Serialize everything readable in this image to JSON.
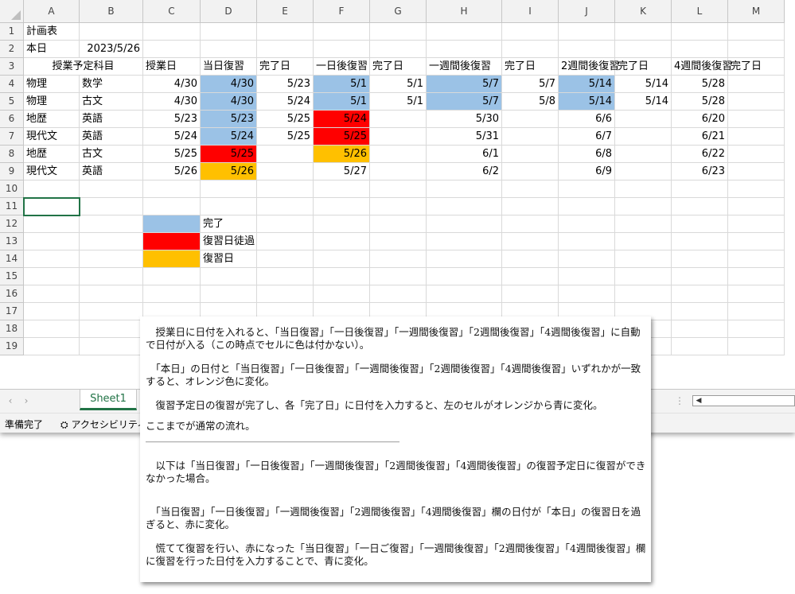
{
  "sheet": {
    "columns": [
      "A",
      "B",
      "C",
      "D",
      "E",
      "F",
      "G",
      "H",
      "I",
      "J",
      "K",
      "L",
      "M"
    ],
    "rows": [
      "1",
      "2",
      "3",
      "4",
      "5",
      "6",
      "7",
      "8",
      "9",
      "10",
      "11",
      "12",
      "13",
      "14",
      "15",
      "16",
      "17",
      "18",
      "19"
    ],
    "cells": {
      "A1": "計画表",
      "A2": "本日",
      "B2": "2023/5/26",
      "A3": "授業予定科目",
      "C3": "授業日",
      "D3": "当日復習",
      "E3": "完了日",
      "F3": "一日後復習",
      "G3": "完了日",
      "H3": "一週間後復習",
      "I3": "完了日",
      "J3": "2週間後復習",
      "K3": "完了日",
      "L3": "4週間後復習",
      "M3": "完了日",
      "A4": "物理",
      "B4": "数学",
      "C4": "4/30",
      "D4": "4/30",
      "E4": "5/23",
      "F4": "5/1",
      "G4": "5/1",
      "H4": "5/7",
      "I4": "5/7",
      "J4": "5/14",
      "K4": "5/14",
      "L4": "5/28",
      "A5": "物理",
      "B5": "古文",
      "C5": "4/30",
      "D5": "4/30",
      "E5": "5/24",
      "F5": "5/1",
      "G5": "5/1",
      "H5": "5/7",
      "I5": "5/8",
      "J5": "5/14",
      "K5": "5/14",
      "L5": "5/28",
      "A6": "地歴",
      "B6": "英語",
      "C6": "5/23",
      "D6": "5/23",
      "E6": "5/25",
      "F6": "5/24",
      "H6": "5/30",
      "J6": "6/6",
      "L6": "6/20",
      "A7": "現代文",
      "B7": "英語",
      "C7": "5/24",
      "D7": "5/24",
      "E7": "5/25",
      "F7": "5/25",
      "H7": "5/31",
      "J7": "6/7",
      "L7": "6/21",
      "A8": "地歴",
      "B8": "古文",
      "C8": "5/25",
      "D8": "5/25",
      "F8": "5/26",
      "H8": "6/1",
      "J8": "6/8",
      "L8": "6/22",
      "A9": "現代文",
      "B9": "英語",
      "C9": "5/26",
      "D9": "5/26",
      "F9": "5/27",
      "H9": "6/2",
      "J9": "6/9",
      "L9": "6/23",
      "D12": "完了",
      "D13": "復習日徒過",
      "D14": "復習日"
    },
    "fills": {
      "D4": "#9bc2e6",
      "F4": "#9bc2e6",
      "H4": "#9bc2e6",
      "J4": "#9bc2e6",
      "D5": "#9bc2e6",
      "F5": "#9bc2e6",
      "H5": "#9bc2e6",
      "J5": "#9bc2e6",
      "D6": "#9bc2e6",
      "F6": "#ff0000",
      "D7": "#9bc2e6",
      "F7": "#ff0000",
      "D8": "#ff0000",
      "F8": "#ffc000",
      "D9": "#ffc000",
      "C12": "#9bc2e6",
      "C13": "#ff0000",
      "C14": "#ffc000"
    },
    "colors": {
      "complete": "#9bc2e6",
      "overdue": "#ff0000",
      "due": "#ffc000",
      "accent": "#217346"
    }
  },
  "tabs": {
    "sheet1": "Sheet1",
    "nav_prev": "‹",
    "nav_next": "›",
    "add": "⊕",
    "more": "⋮"
  },
  "status": {
    "ready": "準備完了",
    "accessibility": "アクセシビリティ: 検"
  },
  "note": {
    "paragraphs": [
      "　授業日に日付を入れると、「当日復習」「一日後復習」「一週間後復習」「2週間後復習」「4週間後復習」に自動で日付が入る（この時点でセルに色は付かない）。",
      "　「本日」の日付と「当日復習」「一日後復習」「一週間後復習」「2週間後復習」「4週間後復習」いずれかが一致すると、オレンジ色に変化。",
      "　復習予定日の復習が完了し、各「完了日」に日付を入力すると、左のセルがオレンジから青に変化。",
      "ここまでが通常の流れ。",
      "―――――――――――――――――――――――――――――",
      "　以下は「当日復習」「一日後復習」「一週間後復習」「2週間後復習」「4週間後復習」の復習予定日に復習ができなかった場合。",
      "　「当日復習」「一日後復習」「一週間後復習」「2週間後復習」「4週間後復習」欄の日付が「本日」の復習日を過ぎると、赤に変化。",
      "　慌てて復習を行い、赤になった「当日復習」「一日ご復習」「一週間後復習」「2週間後復習」「4週間後復習」欄に復習を行った日付を入力することで、青に変化。"
    ]
  }
}
